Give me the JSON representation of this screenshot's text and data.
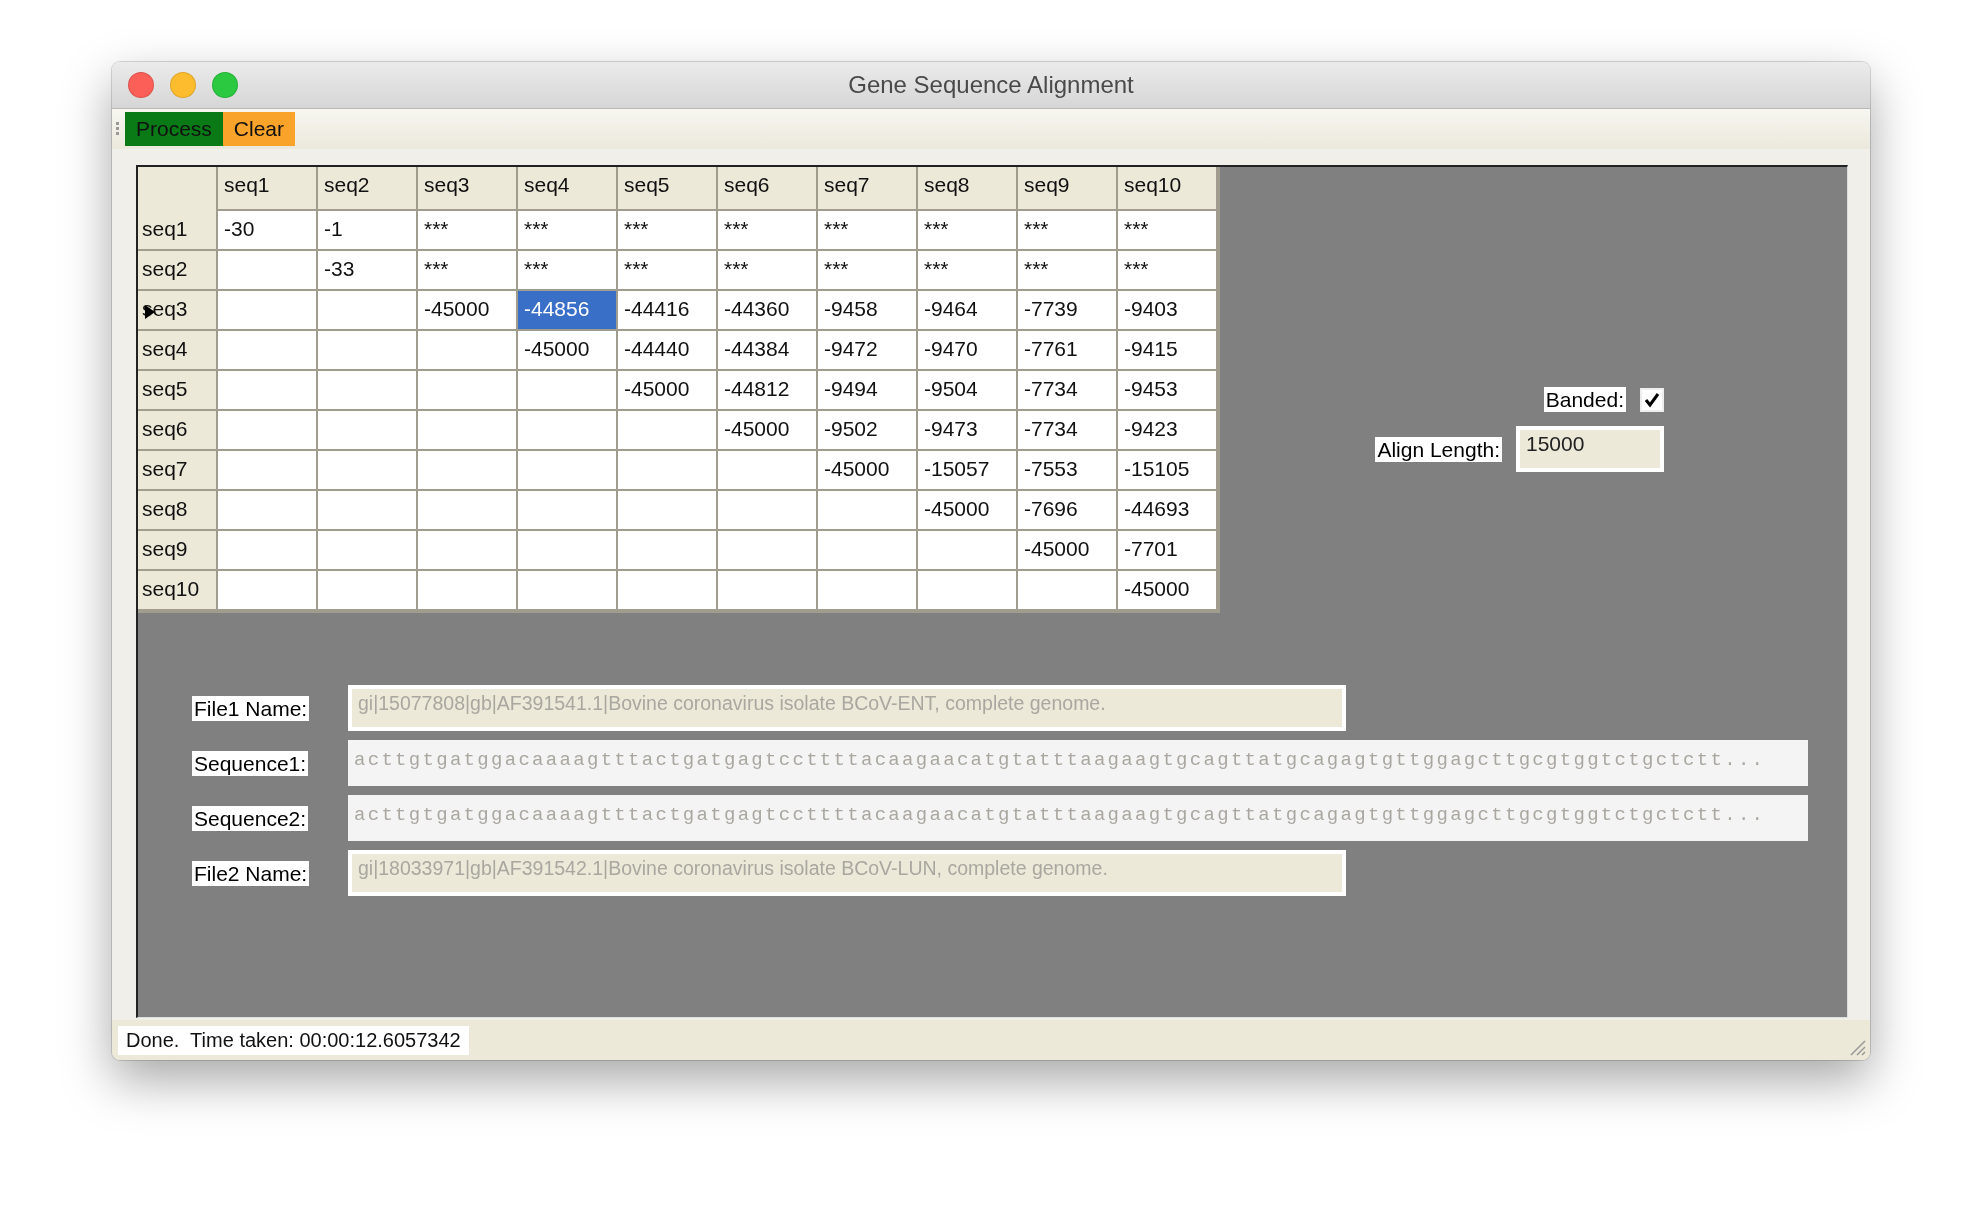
{
  "window": {
    "title": "Gene Sequence Alignment"
  },
  "toolbar": [
    {
      "label": "Process",
      "kind": "process"
    },
    {
      "label": "Clear",
      "kind": "clear"
    }
  ],
  "table": {
    "columns": [
      "seq1",
      "seq2",
      "seq3",
      "seq4",
      "seq5",
      "seq6",
      "seq7",
      "seq8",
      "seq9",
      "seq10"
    ],
    "rows": [
      {
        "label": "seq1",
        "current": false,
        "cells": [
          {
            "text": "-30",
            "selected": false
          },
          {
            "text": "-1",
            "selected": false
          },
          {
            "text": "***",
            "selected": false
          },
          {
            "text": "***",
            "selected": false
          },
          {
            "text": "***",
            "selected": false
          },
          {
            "text": "***",
            "selected": false
          },
          {
            "text": "***",
            "selected": false
          },
          {
            "text": "***",
            "selected": false
          },
          {
            "text": "***",
            "selected": false
          },
          {
            "text": "***",
            "selected": false
          }
        ]
      },
      {
        "label": "seq2",
        "current": false,
        "cells": [
          {
            "selected": false
          },
          {
            "text": "-33",
            "selected": false
          },
          {
            "text": "***",
            "selected": false
          },
          {
            "text": "***",
            "selected": false
          },
          {
            "text": "***",
            "selected": false
          },
          {
            "text": "***",
            "selected": false
          },
          {
            "text": "***",
            "selected": false
          },
          {
            "text": "***",
            "selected": false
          },
          {
            "text": "***",
            "selected": false
          },
          {
            "text": "***",
            "selected": false
          }
        ]
      },
      {
        "label": "seq3",
        "current": true,
        "cells": [
          {
            "selected": false
          },
          {
            "selected": false
          },
          {
            "text": "-45000",
            "selected": false
          },
          {
            "text": "-44856",
            "selected": true
          },
          {
            "text": "-44416",
            "selected": false
          },
          {
            "text": "-44360",
            "selected": false
          },
          {
            "text": "-9458",
            "selected": false
          },
          {
            "text": "-9464",
            "selected": false
          },
          {
            "text": "-7739",
            "selected": false
          },
          {
            "text": "-9403",
            "selected": false
          }
        ]
      },
      {
        "label": "seq4",
        "current": false,
        "cells": [
          {
            "selected": false
          },
          {
            "selected": false
          },
          {
            "selected": false
          },
          {
            "text": "-45000",
            "selected": false
          },
          {
            "text": "-44440",
            "selected": false
          },
          {
            "text": "-44384",
            "selected": false
          },
          {
            "text": "-9472",
            "selected": false
          },
          {
            "text": "-9470",
            "selected": false
          },
          {
            "text": "-7761",
            "selected": false
          },
          {
            "text": "-9415",
            "selected": false
          }
        ]
      },
      {
        "label": "seq5",
        "current": false,
        "cells": [
          {
            "selected": false
          },
          {
            "selected": false
          },
          {
            "selected": false
          },
          {
            "selected": false
          },
          {
            "text": "-45000",
            "selected": false
          },
          {
            "text": "-44812",
            "selected": false
          },
          {
            "text": "-9494",
            "selected": false
          },
          {
            "text": "-9504",
            "selected": false
          },
          {
            "text": "-7734",
            "selected": false
          },
          {
            "text": "-9453",
            "selected": false
          }
        ]
      },
      {
        "label": "seq6",
        "current": false,
        "cells": [
          {
            "selected": false
          },
          {
            "selected": false
          },
          {
            "selected": false
          },
          {
            "selected": false
          },
          {
            "selected": false
          },
          {
            "text": "-45000",
            "selected": false
          },
          {
            "text": "-9502",
            "selected": false
          },
          {
            "text": "-9473",
            "selected": false
          },
          {
            "text": "-7734",
            "selected": false
          },
          {
            "text": "-9423",
            "selected": false
          }
        ]
      },
      {
        "label": "seq7",
        "current": false,
        "cells": [
          {
            "selected": false
          },
          {
            "selected": false
          },
          {
            "selected": false
          },
          {
            "selected": false
          },
          {
            "selected": false
          },
          {
            "selected": false
          },
          {
            "text": "-45000",
            "selected": false
          },
          {
            "text": "-15057",
            "selected": false
          },
          {
            "text": "-7553",
            "selected": false
          },
          {
            "text": "-15105",
            "selected": false
          }
        ]
      },
      {
        "label": "seq8",
        "current": false,
        "cells": [
          {
            "selected": false
          },
          {
            "selected": false
          },
          {
            "selected": false
          },
          {
            "selected": false
          },
          {
            "selected": false
          },
          {
            "selected": false
          },
          {
            "selected": false
          },
          {
            "text": "-45000",
            "selected": false
          },
          {
            "text": "-7696",
            "selected": false
          },
          {
            "text": "-44693",
            "selected": false
          }
        ]
      },
      {
        "label": "seq9",
        "current": false,
        "cells": [
          {
            "selected": false
          },
          {
            "selected": false
          },
          {
            "selected": false
          },
          {
            "selected": false
          },
          {
            "selected": false
          },
          {
            "selected": false
          },
          {
            "selected": false
          },
          {
            "selected": false
          },
          {
            "text": "-45000",
            "selected": false
          },
          {
            "text": "-7701",
            "selected": false
          }
        ]
      },
      {
        "label": "seq10",
        "current": false,
        "cells": [
          {
            "selected": false
          },
          {
            "selected": false
          },
          {
            "selected": false
          },
          {
            "selected": false
          },
          {
            "selected": false
          },
          {
            "selected": false
          },
          {
            "selected": false
          },
          {
            "selected": false
          },
          {
            "selected": false
          },
          {
            "text": "-45000",
            "selected": false
          }
        ]
      }
    ]
  },
  "options": {
    "banded": {
      "label": "Banded:",
      "checked": true
    },
    "align_length": {
      "label": "Align Length:",
      "value": "15000"
    }
  },
  "fields": [
    {
      "label": "File1 Name:",
      "kind": "name",
      "disabled": true,
      "value": "gi|15077808|gb|AF391541.1|Bovine coronavirus isolate BCoV-ENT, complete genome."
    },
    {
      "label": "Sequence1:",
      "kind": "sequence",
      "disabled": true,
      "value": "acttgtgatggacaaaagtttactgatgagtccttttacaagaacatgtatttaagaagtgcagttatgcagagtgttggagcttgcgtggtctgctctt..."
    },
    {
      "label": "Sequence2:",
      "kind": "sequence",
      "disabled": true,
      "value": "acttgtgatggacaaaagtttactgatgagtccttttacaagaacatgtatttaagaagtgcagttatgcagagtgttggagcttgcgtggtctgctctt..."
    },
    {
      "label": "File2 Name:",
      "kind": "name",
      "disabled": true,
      "value": "gi|18033971|gb|AF391542.1|Bovine coronavirus isolate BCoV-LUN, complete genome."
    }
  ],
  "status_bar": {
    "text": "Done.  Time taken: 00:00:12.6057342"
  }
}
